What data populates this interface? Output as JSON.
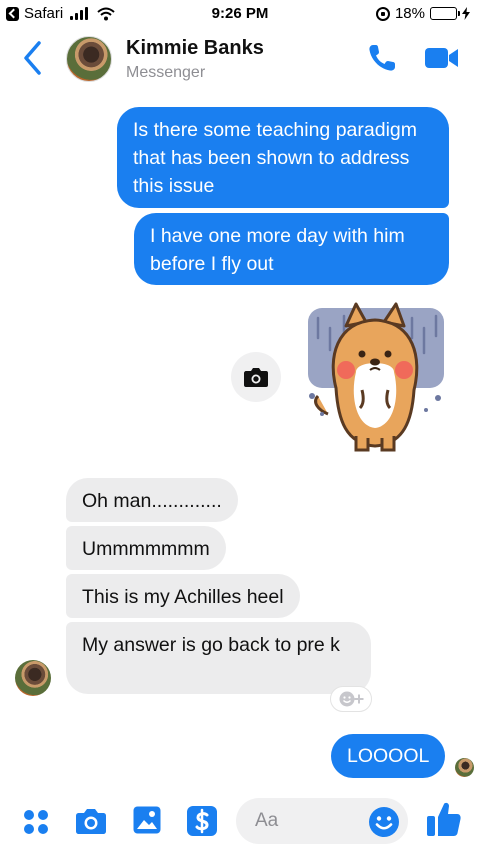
{
  "status_bar": {
    "back_app": "Safari",
    "time": "9:26 PM",
    "battery": "18%",
    "battery_level": 0.18
  },
  "header": {
    "contact_name": "Kimmie Banks",
    "subtitle": "Messenger"
  },
  "messages": [
    {
      "side": "out",
      "text": "Is there some teaching paradigm that has been shown to address this issue"
    },
    {
      "side": "out",
      "text": "I have one more day with him before I fly out"
    },
    {
      "side": "in",
      "text": "Oh man............."
    },
    {
      "side": "in",
      "text": "Ummmmmmm"
    },
    {
      "side": "in",
      "text": "This is my Achilles heel"
    },
    {
      "side": "in",
      "text": "My answer is go back to pre k"
    },
    {
      "side": "out",
      "text": "LOOOOL"
    }
  ],
  "composer": {
    "placeholder": "Aa"
  },
  "colors": {
    "accent": "#1a7ff0",
    "incoming_bubble": "#ececed"
  },
  "icons": [
    "back-app-icon",
    "signal-icon",
    "wifi-icon",
    "rotation-lock-icon",
    "battery-icon",
    "chevron-left-icon",
    "phone-icon",
    "video-camera-icon",
    "camera-icon",
    "sticker",
    "add-reaction-icon",
    "grid-dots-icon",
    "image-icon",
    "dollar-icon",
    "emoji-icon",
    "thumbs-up-icon"
  ]
}
